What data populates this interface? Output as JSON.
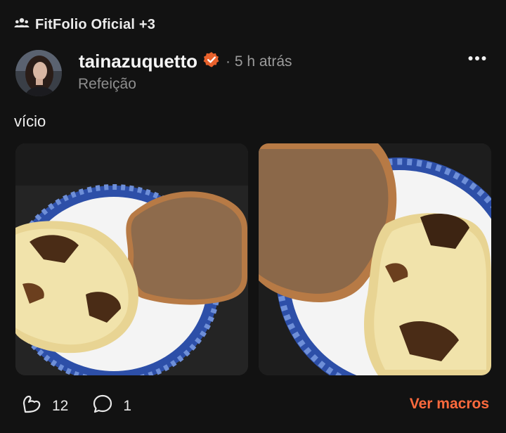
{
  "group": {
    "icon": "group-icon",
    "label": "FitFolio Oficial +3"
  },
  "post": {
    "author": "tainazuquetto",
    "verified_icon": "verified-badge-icon",
    "time": "· 5 h atrás",
    "category": "Refeição",
    "caption": "vício",
    "more_icon": "more-horizontal-icon"
  },
  "actions": {
    "likes_icon": "flexed-arm-icon",
    "likes": "12",
    "comments_icon": "comment-bubble-icon",
    "comments": "1",
    "macros_label": "Ver macros"
  },
  "colors": {
    "background": "#121212",
    "accent": "#ff6a3d",
    "verified": "#e8612c",
    "muted_text": "#8e8e8e"
  }
}
